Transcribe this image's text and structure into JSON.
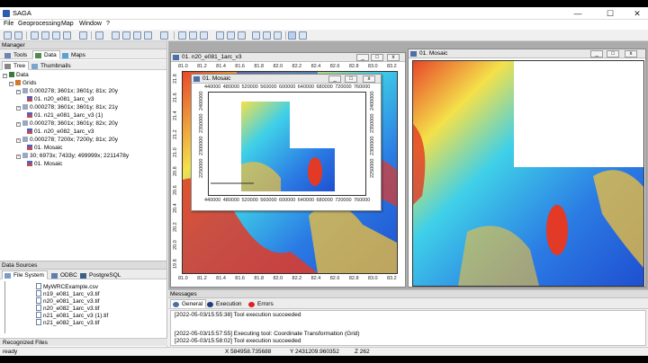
{
  "window": {
    "title": "SAGA",
    "minimize": "—",
    "maximize": "☐",
    "close": "✕"
  },
  "menu": [
    "File",
    "Geoprocessing",
    "Map",
    "Window",
    "?"
  ],
  "manager": {
    "title": "Manager",
    "tabs": {
      "tools": "Tools",
      "data": "Data",
      "maps": "Maps",
      "tree": "Tree",
      "thumbnails": "Thumbnails"
    },
    "tree": [
      {
        "label": "Data",
        "level": 0
      },
      {
        "label": "Grids",
        "level": 1
      },
      {
        "label": "0.000278; 3601x; 3601y; 81x; 20y",
        "level": 2
      },
      {
        "label": "01. n20_e081_1arc_v3",
        "level": 3
      },
      {
        "label": "0.000278; 3601x; 3601y; 81x; 21y",
        "level": 2
      },
      {
        "label": "01. n21_e081_1arc_v3 (1)",
        "level": 3
      },
      {
        "label": "0.000278; 3601x; 3601y; 82x; 20y",
        "level": 2
      },
      {
        "label": "01. n20_e082_1arc_v3",
        "level": 3
      },
      {
        "label": "0.000278; 7200x; 7200y; 81x; 20y",
        "level": 2
      },
      {
        "label": "01. Mosaic",
        "level": 3
      },
      {
        "label": "30; 6973x; 7433y; 499999x; 2211478y",
        "level": 2
      },
      {
        "label": "01. Mosaic",
        "level": 3
      }
    ]
  },
  "sources": {
    "title": "Data Sources",
    "tabs": {
      "fs": "File System",
      "odbc": "ODBC",
      "pg": "PostgreSQL"
    },
    "files": [
      "MyWRCExample.csv",
      "n19_e081_1arc_v3.tif",
      "n20_e081_1arc_v3.tif",
      "n20_e082_1arc_v3.tif",
      "n21_e081_1arc_v3 (1).tif",
      "n21_e082_1arc_v3.tif"
    ],
    "recognized": "Recognized Files"
  },
  "windows": {
    "w1": {
      "title": "01. n20_e081_1arc_v3",
      "xticks": [
        "81.0",
        "81.2",
        "81.4",
        "81.6",
        "81.8",
        "82.0",
        "82.2",
        "82.4",
        "82.6",
        "82.8",
        "83.0",
        "83.2"
      ],
      "yticks": [
        "21.8",
        "21.6",
        "21.4",
        "21.2",
        "21.0",
        "20.8",
        "20.6",
        "20.4",
        "20.2",
        "20.0",
        "19.8"
      ]
    },
    "w2": {
      "title": "01. Mosaic",
      "xticks": [
        "440000",
        "480000",
        "520000",
        "560000",
        "600000",
        "640000",
        "680000",
        "720000",
        "760000"
      ],
      "yticks": [
        "2400000",
        "2350000",
        "2300000",
        "2250000"
      ]
    },
    "w3": {
      "title": "01. Mosaic"
    }
  },
  "messages": {
    "title": "Messages",
    "tabs": {
      "general": "General",
      "execution": "Execution",
      "errors": "Errors"
    },
    "lines": [
      "[2022-05-03/15:55:38] Tool execution succeeded",
      "[2022-05-03/15:57:55] Executing tool: Coordinate Transformation (Grid)",
      "[2022-05-03/15:58:02] Tool execution succeeded"
    ]
  },
  "status": {
    "ready": "ready",
    "x": "X 584958.735688",
    "y": "Y 2431209.960352",
    "z": "Z 262"
  }
}
